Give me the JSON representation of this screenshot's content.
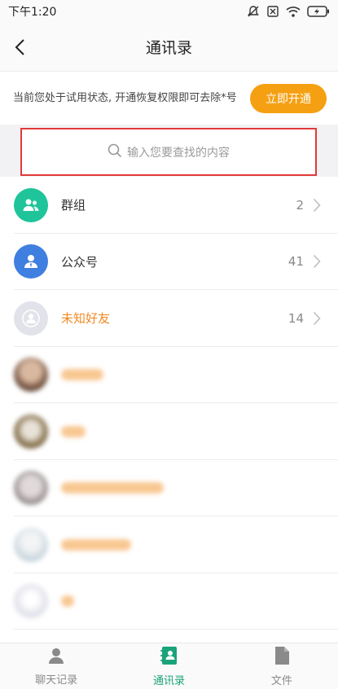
{
  "status_bar": {
    "time": "下午1:20"
  },
  "nav": {
    "title": "通讯录"
  },
  "trial_banner": {
    "text": "当前您处于试用状态, 开通恢复权限即可去除*号",
    "button_label": "立即开通"
  },
  "search": {
    "placeholder": "输入您要查找的内容"
  },
  "categories": [
    {
      "label": "群组",
      "count": "2",
      "icon": "group-icon",
      "color": "#1fc49a"
    },
    {
      "label": "公众号",
      "count": "41",
      "icon": "official-account-icon",
      "color": "#3f7fe0"
    },
    {
      "label": "未知好友",
      "count": "14",
      "icon": "unknown-friend-icon",
      "color": "#e2e2ea"
    }
  ],
  "tabs": [
    {
      "label": "聊天记录",
      "icon": "chat-records-icon",
      "active": false
    },
    {
      "label": "通讯录",
      "icon": "contacts-icon",
      "active": true
    },
    {
      "label": "文件",
      "icon": "file-icon",
      "active": false
    }
  ],
  "colors": {
    "accent_orange": "#f5a012",
    "active_green": "#1aa37a",
    "highlight_red": "#e03a3a"
  }
}
